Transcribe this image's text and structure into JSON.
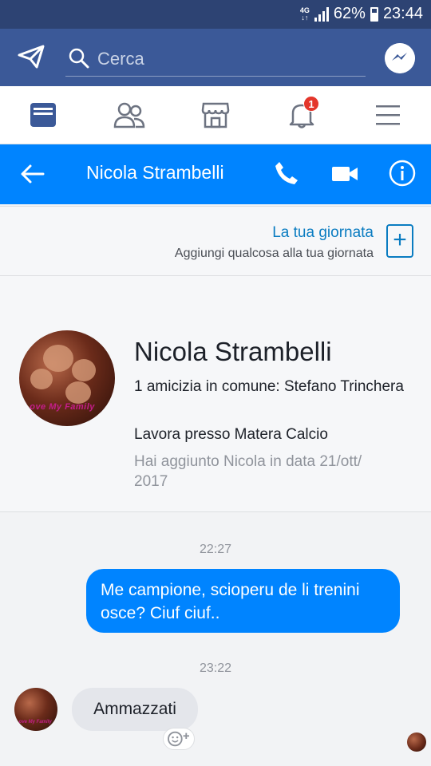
{
  "status_bar": {
    "network": "4G",
    "battery": "62%",
    "time": "23:44"
  },
  "top_bar": {
    "search_placeholder": "Cerca"
  },
  "nav": {
    "notification_count": "1"
  },
  "chat_header": {
    "title": "Nicola Strambelli"
  },
  "day_card": {
    "title": "La tua giornata",
    "subtitle": "Aggiungi qualcosa alla tua giornata",
    "add": "+"
  },
  "profile": {
    "name": "Nicola Strambelli",
    "avatar_caption": "Love My Family",
    "mutual": "1 amicizia in comune: Stefano Trinchera",
    "work": "Lavora presso Matera Calcio",
    "added": "Hai aggiunto Nicola in data 21/ott/ 2017"
  },
  "messages": [
    {
      "time": "22:27",
      "direction": "out",
      "text": "Me campione, scioperu de li trenini osce? Ciuf ciuf.."
    },
    {
      "time": "23:22",
      "direction": "in",
      "text": "Ammazzati"
    }
  ],
  "colors": {
    "facebook_blue": "#3b5998",
    "messenger_blue": "#0084ff",
    "status_bar": "#2d4373"
  }
}
